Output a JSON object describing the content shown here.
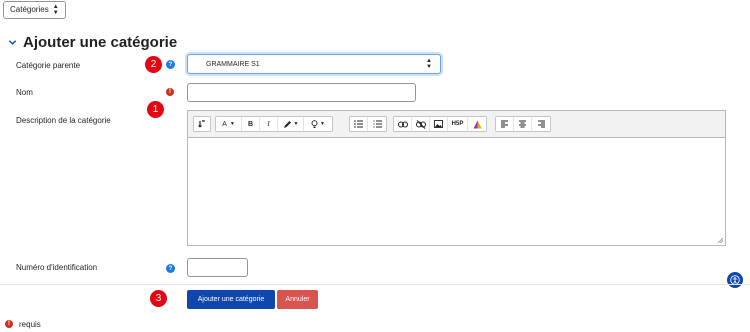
{
  "top_select": {
    "value": "Catégories"
  },
  "section": {
    "title": "Ajouter une catégorie"
  },
  "form": {
    "parent_label": "Catégorie parente",
    "parent_value": "GRAMMAIRE S1",
    "name_label": "Nom",
    "name_value": "",
    "description_label": "Description de la catégorie",
    "idnumber_label": "Numéro d'identification",
    "idnumber_value": ""
  },
  "toolbar": {
    "font_a": "A",
    "bold": "B",
    "italic": "I",
    "h5p": "H5P"
  },
  "annotations": {
    "one": "1",
    "two": "2",
    "three": "3"
  },
  "buttons": {
    "submit": "Ajouter une catégorie",
    "cancel": "Annuler"
  },
  "footer": {
    "required_label": "requis"
  },
  "colors": {
    "primary": "#0f47ad",
    "danger": "#d9534f",
    "required": "#ca3120",
    "help": "#1f7ae0",
    "annotation": "#e30613"
  }
}
